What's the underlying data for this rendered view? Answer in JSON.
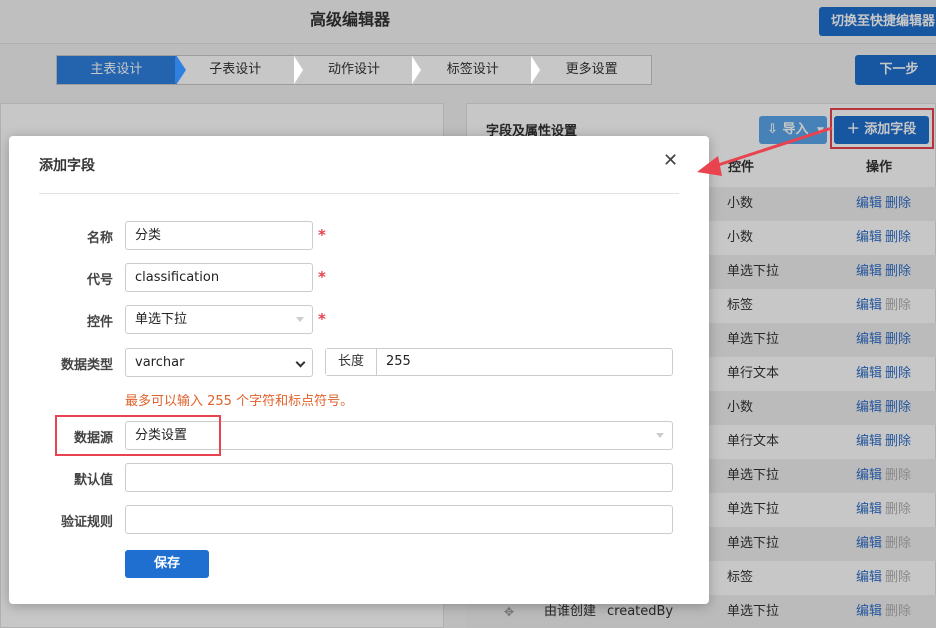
{
  "app": {
    "title": "高级编辑器",
    "switch_button": "切换至快捷编辑器",
    "next_button": "下一步"
  },
  "steps": [
    "主表设计",
    "子表设计",
    "动作设计",
    "标签设计",
    "更多设置"
  ],
  "active_step": 0,
  "right_panel": {
    "title": "字段及属性设置",
    "import_button": "导入",
    "add_button": "添加字段",
    "col_control": "控件",
    "col_operation": "操作",
    "rows": [
      {
        "control": "小数",
        "edit": "编辑",
        "delete": "删除",
        "delete_disabled": false
      },
      {
        "control": "小数",
        "edit": "编辑",
        "delete": "删除",
        "delete_disabled": false
      },
      {
        "control": "单选下拉",
        "edit": "编辑",
        "delete": "删除",
        "delete_disabled": false
      },
      {
        "control": "标签",
        "edit": "编辑",
        "delete": "删除",
        "delete_disabled": true
      },
      {
        "control": "单选下拉",
        "edit": "编辑",
        "delete": "删除",
        "delete_disabled": false
      },
      {
        "control": "单行文本",
        "edit": "编辑",
        "delete": "删除",
        "delete_disabled": false
      },
      {
        "control": "小数",
        "edit": "编辑",
        "delete": "删除",
        "delete_disabled": false
      },
      {
        "control": "单行文本",
        "edit": "编辑",
        "delete": "删除",
        "delete_disabled": false
      },
      {
        "control": "单选下拉",
        "edit": "编辑",
        "delete": "删除",
        "delete_disabled": true
      },
      {
        "control": "单选下拉",
        "edit": "编辑",
        "delete": "删除",
        "delete_disabled": true
      },
      {
        "control": "单选下拉",
        "edit": "编辑",
        "delete": "删除",
        "delete_disabled": true
      },
      {
        "control": "标签",
        "edit": "编辑",
        "delete": "删除",
        "delete_disabled": true
      },
      {
        "name": "由谁创建",
        "code": "createdBy",
        "control": "单选下拉",
        "edit": "编辑",
        "delete": "删除",
        "delete_disabled": true
      }
    ]
  },
  "modal": {
    "title": "添加字段",
    "close_icon": "close-icon",
    "fields": {
      "name": {
        "label": "名称",
        "value": "分类",
        "required": "*"
      },
      "code": {
        "label": "代号",
        "value": "classification",
        "required": "*"
      },
      "control": {
        "label": "控件",
        "value": "单选下拉",
        "required": "*"
      },
      "data_type": {
        "label": "数据类型",
        "value": "varchar",
        "length_label": "长度",
        "length_value": "255"
      },
      "hint": "最多可以输入 255 个字符和标点符号。",
      "data_source": {
        "label": "数据源",
        "value": "分类设置"
      },
      "default_value": {
        "label": "默认值",
        "value": ""
      },
      "validation": {
        "label": "验证规则",
        "value": ""
      }
    },
    "save_button": "保存"
  },
  "colors": {
    "primary": "#1e6fcf",
    "step_active": "#2f80e0",
    "annotation_red": "#e8434f",
    "hint_orange": "#e0622b",
    "link_blue": "#2f6fc9"
  }
}
